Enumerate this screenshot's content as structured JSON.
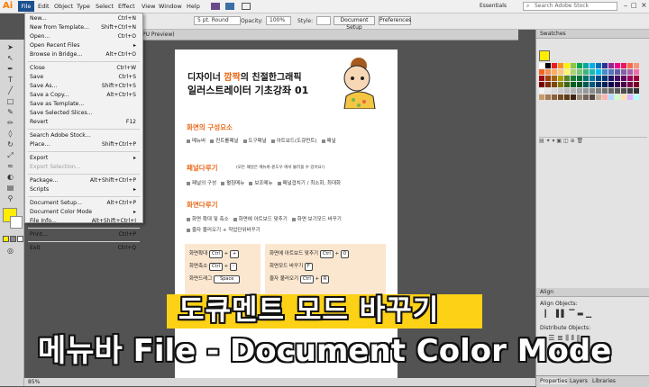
{
  "app": {
    "logo": "Ai"
  },
  "menubar": {
    "items": [
      "File",
      "Edit",
      "Object",
      "Type",
      "Select",
      "Effect",
      "View",
      "Window",
      "Help"
    ],
    "workspace": "Essentials",
    "search_placeholder": "Search Adobe Stock"
  },
  "controlbar": {
    "stroke_weight": "5 pt. Round",
    "opacity_label": "Opacity:",
    "opacity_value": "100%",
    "style_label": "Style:",
    "document_setup": "Document Setup",
    "preferences": "Preferences"
  },
  "document_tab": "PU Preview)",
  "file_menu": [
    {
      "label": "New...",
      "shortcut": "Ctrl+N"
    },
    {
      "label": "New from Template...",
      "shortcut": "Shift+Ctrl+N"
    },
    {
      "label": "Open...",
      "shortcut": "Ctrl+O"
    },
    {
      "label": "Open Recent Files",
      "shortcut": "▸"
    },
    {
      "label": "Browse in Bridge...",
      "shortcut": "Alt+Ctrl+O"
    },
    {
      "sep": true
    },
    {
      "label": "Close",
      "shortcut": "Ctrl+W"
    },
    {
      "label": "Save",
      "shortcut": "Ctrl+S"
    },
    {
      "label": "Save As...",
      "shortcut": "Shift+Ctrl+S"
    },
    {
      "label": "Save a Copy...",
      "shortcut": "Alt+Ctrl+S"
    },
    {
      "label": "Save as Template..."
    },
    {
      "label": "Save Selected Slices..."
    },
    {
      "label": "Revert",
      "shortcut": "F12"
    },
    {
      "sep": true
    },
    {
      "label": "Search Adobe Stock..."
    },
    {
      "label": "Place...",
      "shortcut": "Shift+Ctrl+P"
    },
    {
      "sep": true
    },
    {
      "label": "Export",
      "shortcut": "▸"
    },
    {
      "label": "Export Selection...",
      "disabled": true
    },
    {
      "sep": true
    },
    {
      "label": "Package...",
      "shortcut": "Alt+Shift+Ctrl+P"
    },
    {
      "label": "Scripts",
      "shortcut": "▸"
    },
    {
      "sep": true
    },
    {
      "label": "Document Setup...",
      "shortcut": "Alt+Ctrl+P"
    },
    {
      "label": "Document Color Mode",
      "shortcut": "▸"
    },
    {
      "label": "File Info...",
      "shortcut": "Alt+Shift+Ctrl+I"
    },
    {
      "sep": true
    },
    {
      "label": "Print...",
      "shortcut": "Ctrl+P"
    },
    {
      "sep": true
    },
    {
      "label": "Exit",
      "shortcut": "Ctrl+Q"
    }
  ],
  "artboard": {
    "title_line1_a": "디자이너 ",
    "title_line1_b": "깜짝",
    "title_line1_c": "의 친절한그래픽",
    "title_line2": "일러스트레이터 기초강좌 01",
    "section1": "화면의 구성요소",
    "section1_tags": [
      "메뉴바",
      "컨트롤패널",
      "도구패널",
      "아트보드(도큐먼트)",
      "패널"
    ],
    "section2": "패널다루기",
    "section2_note": "(모든 패널은 메뉴바-윈도우 에서 불러올 수 있어요!)",
    "section2_tags": [
      "패널의 구성",
      "펼침메뉴",
      "보조메뉴",
      "패널겹치기 / 최소화, 최대화"
    ],
    "section3": "화면다루기",
    "section3_row1": [
      "화면 확대 및 축소",
      "화면에 아트보드 맞추기",
      "화면 보기모드 바꾸기"
    ],
    "section3_row2": [
      "줄자 불러오기 + 작업단위바꾸기"
    ],
    "box_left": [
      {
        "label": "화면확대",
        "keys": [
          "Ctrl",
          "+"
        ]
      },
      {
        "label": "화면축소",
        "keys": [
          "Ctrl",
          "-"
        ]
      },
      {
        "label": "화면드래그",
        "keys": [
          "Space"
        ]
      }
    ],
    "box_right": [
      {
        "label": "화면에 아트보드 맞추기",
        "keys": [
          "Ctrl",
          "0"
        ]
      },
      {
        "label": "화면모드 바꾸기",
        "keys": [
          "F"
        ]
      },
      {
        "label": "줄자 불러오기",
        "keys": [
          "Ctrl",
          "R"
        ]
      }
    ]
  },
  "panels": {
    "swatches": "Swatches",
    "align": "Align",
    "align_objects": "Align Objects:",
    "distribute_objects": "Distribute Objects:",
    "tabs": [
      "Properties",
      "Layers",
      "Libraries"
    ]
  },
  "status": {
    "zoom": "85%"
  },
  "caption": {
    "line1": "도큐멘트 모드 바꾸기",
    "line2": "메뉴바 File - Document Color Mode"
  },
  "colors": {
    "accent": "#1c4f8e",
    "highlight": "#fcd116",
    "fill": "#ffed00",
    "orange": "#e86a1a"
  }
}
